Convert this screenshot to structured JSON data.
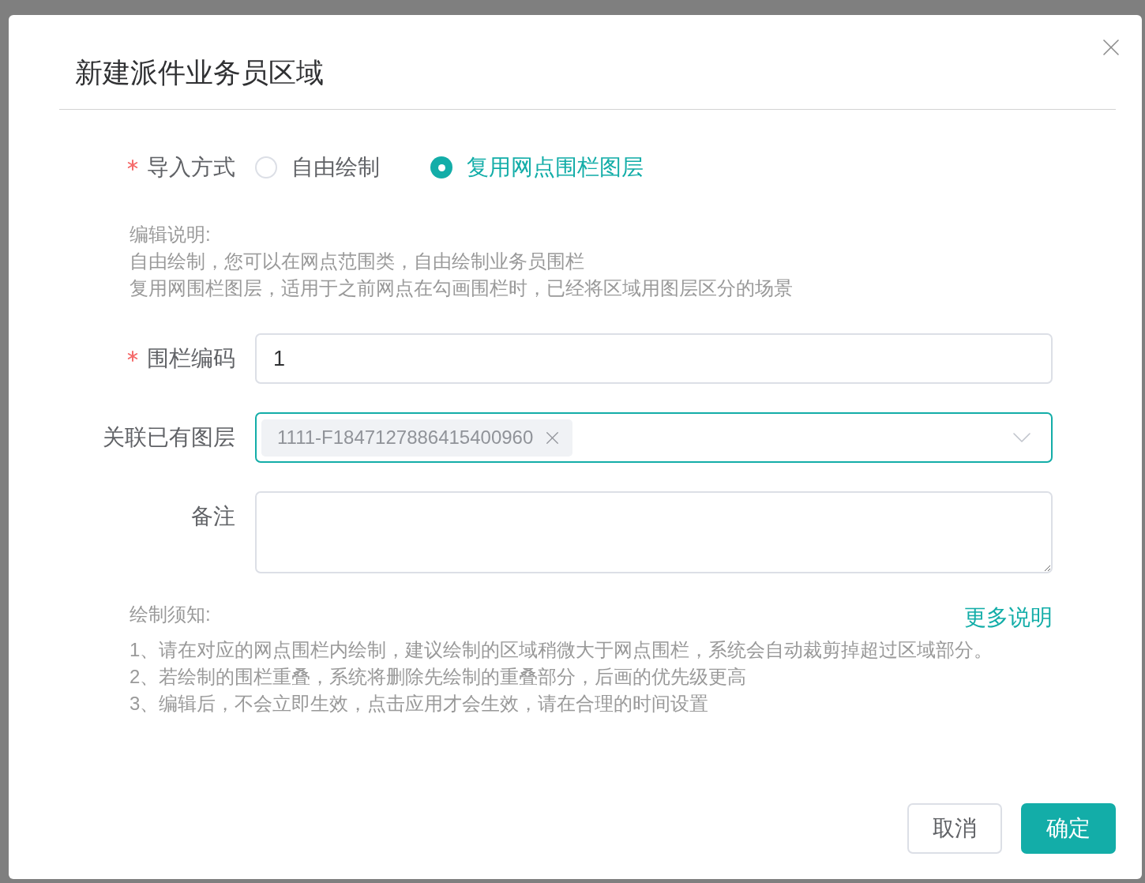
{
  "dialog": {
    "title": "新建派件业务员区域"
  },
  "import_method": {
    "label": "导入方式",
    "required": true,
    "options": [
      {
        "label": "自由绘制",
        "selected": false
      },
      {
        "label": "复用网点围栏图层",
        "selected": true
      }
    ]
  },
  "edit_notes": {
    "title": "编辑说明:",
    "lines": [
      "自由绘制，您可以在网点范围类，自由绘制业务员围栏",
      "复用网围栏图层，适用于之前网点在勾画围栏时，已经将区域用图层区分的场景"
    ]
  },
  "fields": [
    {
      "kind": "input",
      "label": "围栏编码",
      "required": true,
      "focused": false,
      "value": "1"
    },
    {
      "kind": "select",
      "label": "关联已有图层",
      "required": false,
      "focused": true,
      "tags": [
        "1111-F1847127886415400960"
      ]
    },
    {
      "kind": "textarea",
      "label": "备注",
      "required": false,
      "focused": false
    }
  ],
  "drawing_notes": {
    "title": "绘制须知:",
    "link": "更多说明",
    "lines": [
      "1、请在对应的网点围栏内绘制，建议绘制的区域稍微大于网点围栏，系统会自动裁剪掉超过区域部分。",
      "2、若绘制的围栏重叠，系统将删除先绘制的重叠部分，后画的优先级更高",
      "3、编辑后，不会立即生效，点击应用才会生效，请在合理的时间设置"
    ]
  },
  "buttons": [
    {
      "label": "取消",
      "kind": "secondary"
    },
    {
      "label": "确定",
      "kind": "primary"
    }
  ]
}
